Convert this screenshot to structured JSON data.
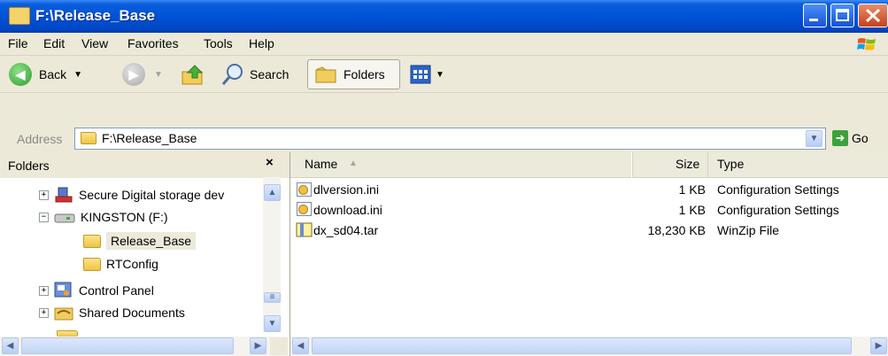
{
  "window": {
    "title": "F:\\Release_Base"
  },
  "menubar": {
    "items": [
      "File",
      "Edit",
      "View",
      "Favorites",
      "Tools",
      "Help"
    ]
  },
  "toolbar": {
    "back_label": "Back",
    "search_label": "Search",
    "folders_label": "Folders"
  },
  "address": {
    "label": "Address",
    "value": "F:\\Release_Base",
    "go_label": "Go"
  },
  "folders_pane": {
    "title": "Folders",
    "items": [
      {
        "label": "Secure Digital storage dev",
        "expander": "+"
      },
      {
        "label": "KINGSTON (F:)",
        "expander": "−"
      },
      {
        "label": "Release_Base",
        "selected": true
      },
      {
        "label": "RTConfig"
      },
      {
        "label": "Control Panel",
        "expander": "+"
      },
      {
        "label": "Shared Documents",
        "expander": "+"
      }
    ]
  },
  "file_list": {
    "columns": {
      "name": "Name",
      "size": "Size",
      "type": "Type"
    },
    "rows": [
      {
        "name": "dlversion.ini",
        "size": "1 KB",
        "type": "Configuration Settings"
      },
      {
        "name": "download.ini",
        "size": "1 KB",
        "type": "Configuration Settings"
      },
      {
        "name": "dx_sd04.tar",
        "size": "18,230 KB",
        "type": "WinZip File"
      }
    ]
  },
  "colors": {
    "titlebar": "#0052d6",
    "selection": "#ebeadb",
    "close": "#c8401b"
  },
  "icons": [
    "folder-icon",
    "back-arrow-icon",
    "forward-arrow-icon",
    "up-folder-icon",
    "search-icon",
    "folders-icon",
    "views-icon",
    "go-arrow-icon",
    "windows-logo-icon",
    "ini-file-icon",
    "winzip-file-icon",
    "removable-drive-icon",
    "control-panel-icon",
    "shared-documents-icon",
    "sd-storage-icon"
  ]
}
